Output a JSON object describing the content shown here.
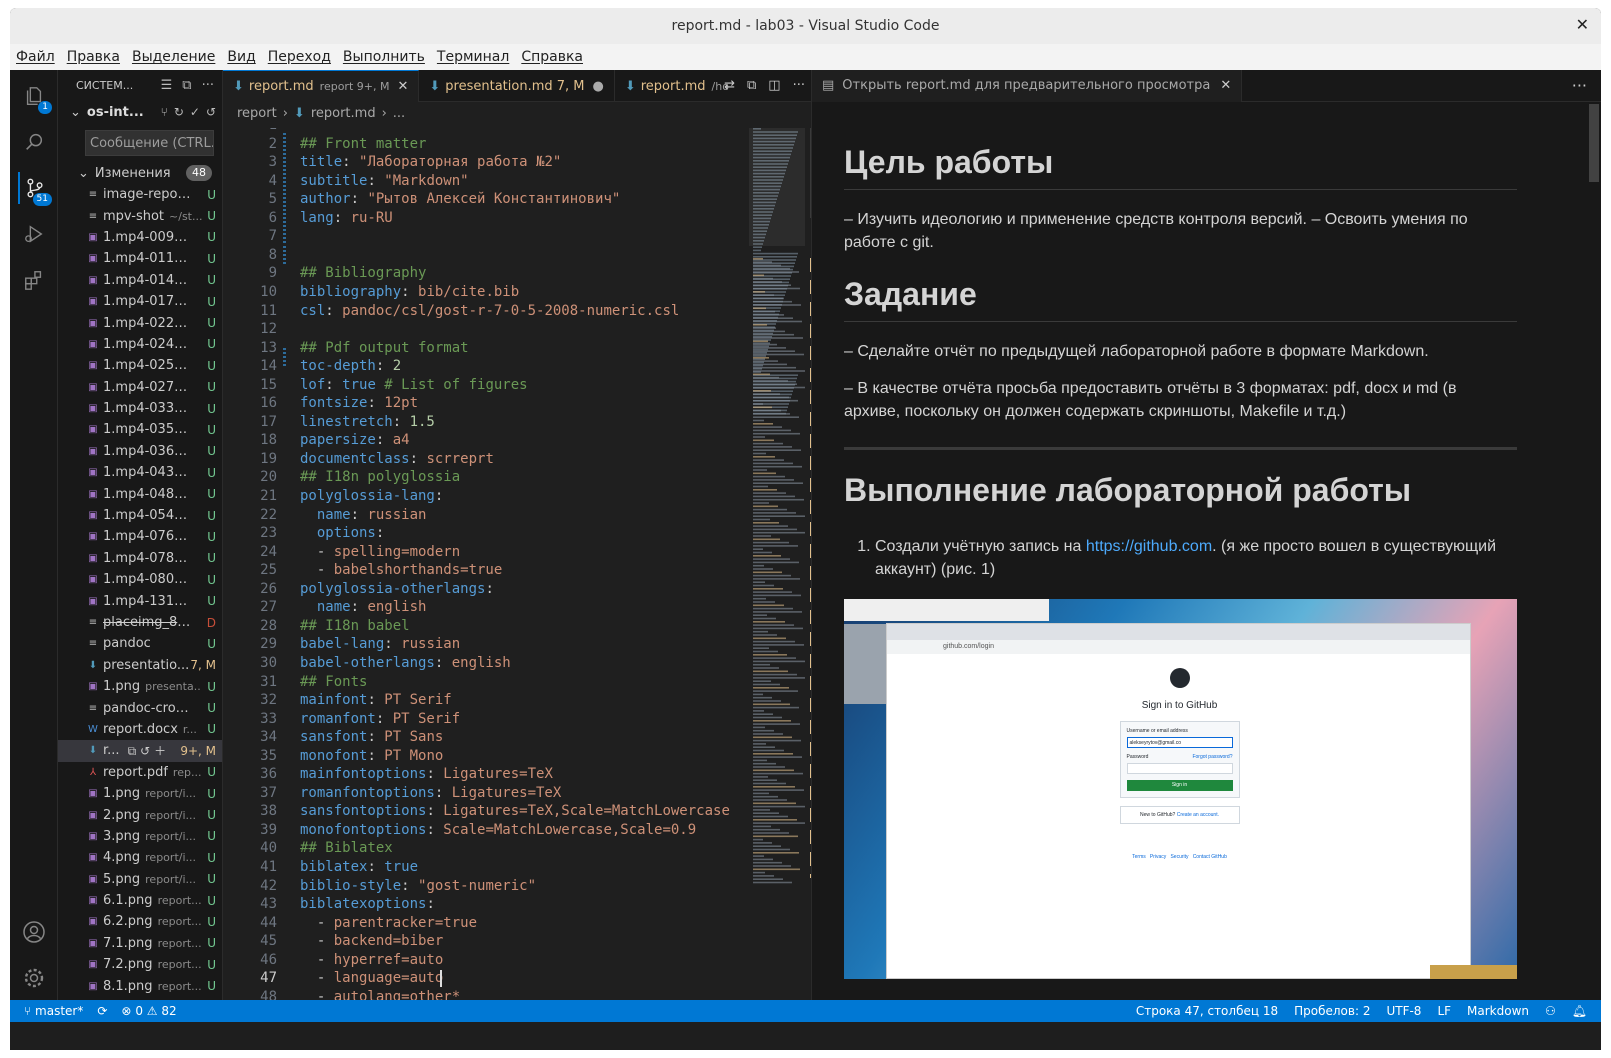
{
  "window": {
    "title": "report.md - lab03 - Visual Studio Code",
    "close": "✕"
  },
  "menu": [
    "Файл",
    "Правка",
    "Выделение",
    "Вид",
    "Переход",
    "Выполнить",
    "Терминал",
    "Справка"
  ],
  "activity": {
    "explorer_badge": "1",
    "scm_badge": "51"
  },
  "sidebar": {
    "header": "СИСТЕМ...",
    "repo": "os-int...",
    "message_placeholder": "Сообщение (CTRL...",
    "changes_label": "Изменения",
    "changes_count": "48",
    "files": [
      {
        "icon": "≡",
        "name": "image-report...",
        "dir": "",
        "status": "U"
      },
      {
        "icon": "≡",
        "name": "mpv-shot",
        "dir": "~/st...",
        "status": "U"
      },
      {
        "icon": "▣",
        "name": "1.mp4-0096.j...",
        "dir": "",
        "status": "U"
      },
      {
        "icon": "▣",
        "name": "1.mp4-0112.jp...",
        "dir": "",
        "status": "U"
      },
      {
        "icon": "▣",
        "name": "1.mp4-0144.j...",
        "dir": "",
        "status": "U"
      },
      {
        "icon": "▣",
        "name": "1.mp4-0176.jp...",
        "dir": "",
        "status": "U"
      },
      {
        "icon": "▣",
        "name": "1.mp4-0224.j...",
        "dir": "",
        "status": "U"
      },
      {
        "icon": "▣",
        "name": "1.mp4-0240.j...",
        "dir": "",
        "status": "U"
      },
      {
        "icon": "▣",
        "name": "1.mp4-0256.j...",
        "dir": "",
        "status": "U"
      },
      {
        "icon": "▣",
        "name": "1.mp4-0272.j...",
        "dir": "",
        "status": "U"
      },
      {
        "icon": "▣",
        "name": "1.mp4-0336.j...",
        "dir": "",
        "status": "U"
      },
      {
        "icon": "▣",
        "name": "1.mp4-0352.j...",
        "dir": "",
        "status": "U"
      },
      {
        "icon": "▣",
        "name": "1.mp4-0368.j...",
        "dir": "",
        "status": "U"
      },
      {
        "icon": "▣",
        "name": "1.mp4-0432.j...",
        "dir": "",
        "status": "U"
      },
      {
        "icon": "▣",
        "name": "1.mp4-0480.j...",
        "dir": "",
        "status": "U"
      },
      {
        "icon": "▣",
        "name": "1.mp4-0544.j...",
        "dir": "",
        "status": "U"
      },
      {
        "icon": "▣",
        "name": "1.mp4-0768.j...",
        "dir": "",
        "status": "U"
      },
      {
        "icon": "▣",
        "name": "1.mp4-0784.j...",
        "dir": "",
        "status": "U"
      },
      {
        "icon": "▣",
        "name": "1.mp4-0800.j...",
        "dir": "",
        "status": "U"
      },
      {
        "icon": "▣",
        "name": "1.mp4-1312.jp...",
        "dir": "",
        "status": "U"
      },
      {
        "icon": "≡",
        "name": "placeimg_80...",
        "dir": "",
        "status": "D",
        "strike": true
      },
      {
        "icon": "≡",
        "name": "pandoc",
        "dir": "",
        "status": "U"
      },
      {
        "icon": "⬇",
        "name": "presentatio...",
        "dir": "",
        "status": "7, M"
      },
      {
        "icon": "▣",
        "name": "1.png",
        "dir": "presenta...",
        "status": "U"
      },
      {
        "icon": "≡",
        "name": "pandoc-cross...",
        "dir": "",
        "status": "U"
      },
      {
        "icon": "W",
        "name": "report.docx",
        "dir": "r...",
        "status": "U"
      },
      {
        "icon": "⬇",
        "name": "r...",
        "dir": "",
        "status": "9+, M",
        "selected": true
      },
      {
        "icon": "⅄",
        "name": "report.pdf",
        "dir": "rep...",
        "status": "U"
      },
      {
        "icon": "▣",
        "name": "1.png",
        "dir": "report/i...",
        "status": "U"
      },
      {
        "icon": "▣",
        "name": "2.png",
        "dir": "report/i...",
        "status": "U"
      },
      {
        "icon": "▣",
        "name": "3.png",
        "dir": "report/i...",
        "status": "U"
      },
      {
        "icon": "▣",
        "name": "4.png",
        "dir": "report/i...",
        "status": "U"
      },
      {
        "icon": "▣",
        "name": "5.png",
        "dir": "report/i...",
        "status": "U"
      },
      {
        "icon": "▣",
        "name": "6.1.png",
        "dir": "report...",
        "status": "U"
      },
      {
        "icon": "▣",
        "name": "6.2.png",
        "dir": "report...",
        "status": "U"
      },
      {
        "icon": "▣",
        "name": "7.1.png",
        "dir": "report...",
        "status": "U"
      },
      {
        "icon": "▣",
        "name": "7.2.png",
        "dir": "report...",
        "status": "U"
      },
      {
        "icon": "▣",
        "name": "8.1.png",
        "dir": "report...",
        "status": "U"
      }
    ]
  },
  "editor": {
    "tabs": [
      {
        "label": "report.md",
        "desc": "report 9+, M",
        "close": "✕",
        "active": true
      },
      {
        "label": "presentation.md 7, M",
        "desc": "",
        "close": "●",
        "active": false
      },
      {
        "label": "report.md",
        "desc": "/ho",
        "close": "",
        "active": false
      }
    ],
    "breadcrumb": [
      "report",
      "›",
      "report.md",
      "›",
      "..."
    ],
    "current_line": 47,
    "lines": [
      {
        "n": "1",
        "t": [
          [
            "---",
            "#cccccc"
          ]
        ]
      },
      {
        "n": "2",
        "t": [
          [
            "## Front matter",
            "#6a9955"
          ]
        ]
      },
      {
        "n": "3",
        "t": [
          [
            "title",
            "#569cd6"
          ],
          [
            ": ",
            "#cccccc"
          ],
          [
            "\"Лабораторная работа №2\"",
            "#ce9178"
          ]
        ]
      },
      {
        "n": "4",
        "t": [
          [
            "subtitle",
            "#569cd6"
          ],
          [
            ": ",
            "#cccccc"
          ],
          [
            "\"Markdown\"",
            "#ce9178"
          ]
        ]
      },
      {
        "n": "5",
        "t": [
          [
            "author",
            "#569cd6"
          ],
          [
            ": ",
            "#cccccc"
          ],
          [
            "\"Рытов Алексей Константинович\"",
            "#ce9178"
          ]
        ]
      },
      {
        "n": "6",
        "t": [
          [
            "lang",
            "#569cd6"
          ],
          [
            ": ",
            "#cccccc"
          ],
          [
            "ru-RU",
            "#ce9178"
          ]
        ]
      },
      {
        "n": "7",
        "t": [
          [
            "",
            "#cccccc"
          ]
        ]
      },
      {
        "n": "8",
        "t": [
          [
            "",
            "#cccccc"
          ]
        ]
      },
      {
        "n": "9",
        "t": [
          [
            "## Bibliography",
            "#6a9955"
          ]
        ]
      },
      {
        "n": "10",
        "t": [
          [
            "bibliography",
            "#569cd6"
          ],
          [
            ": ",
            "#cccccc"
          ],
          [
            "bib/cite.bib",
            "#ce9178"
          ]
        ]
      },
      {
        "n": "11",
        "t": [
          [
            "csl",
            "#569cd6"
          ],
          [
            ": ",
            "#cccccc"
          ],
          [
            "pandoc/csl/gost-r-7-0-5-2008-numeric.csl",
            "#ce9178"
          ]
        ]
      },
      {
        "n": "12",
        "t": [
          [
            "",
            "#cccccc"
          ]
        ]
      },
      {
        "n": "13",
        "t": [
          [
            "## Pdf output format",
            "#6a9955"
          ]
        ]
      },
      {
        "n": "14",
        "t": [
          [
            "toc-depth",
            "#569cd6"
          ],
          [
            ": ",
            "#cccccc"
          ],
          [
            "2",
            "#b5cea8"
          ]
        ]
      },
      {
        "n": "15",
        "t": [
          [
            "lof",
            "#569cd6"
          ],
          [
            ": ",
            "#cccccc"
          ],
          [
            "true",
            "#569cd6"
          ],
          [
            " # List of figures",
            "#6a9955"
          ]
        ]
      },
      {
        "n": "16",
        "t": [
          [
            "fontsize",
            "#569cd6"
          ],
          [
            ": ",
            "#cccccc"
          ],
          [
            "12pt",
            "#ce9178"
          ]
        ]
      },
      {
        "n": "17",
        "t": [
          [
            "linestretch",
            "#569cd6"
          ],
          [
            ": ",
            "#cccccc"
          ],
          [
            "1.5",
            "#b5cea8"
          ]
        ]
      },
      {
        "n": "18",
        "t": [
          [
            "papersize",
            "#569cd6"
          ],
          [
            ": ",
            "#cccccc"
          ],
          [
            "a4",
            "#ce9178"
          ]
        ]
      },
      {
        "n": "19",
        "t": [
          [
            "documentclass",
            "#569cd6"
          ],
          [
            ": ",
            "#cccccc"
          ],
          [
            "scrreprt",
            "#ce9178"
          ]
        ]
      },
      {
        "n": "20",
        "t": [
          [
            "## I18n polyglossia",
            "#6a9955"
          ]
        ]
      },
      {
        "n": "21",
        "t": [
          [
            "polyglossia-lang",
            "#569cd6"
          ],
          [
            ":",
            "#cccccc"
          ]
        ]
      },
      {
        "n": "22",
        "t": [
          [
            "  name",
            "#569cd6"
          ],
          [
            ": ",
            "#cccccc"
          ],
          [
            "russian",
            "#ce9178"
          ]
        ]
      },
      {
        "n": "23",
        "t": [
          [
            "  options",
            "#569cd6"
          ],
          [
            ":",
            "#cccccc"
          ]
        ]
      },
      {
        "n": "24",
        "t": [
          [
            "  - ",
            "#cccccc"
          ],
          [
            "spelling=modern",
            "#ce9178"
          ]
        ]
      },
      {
        "n": "25",
        "t": [
          [
            "  - ",
            "#cccccc"
          ],
          [
            "babelshorthands=true",
            "#ce9178"
          ]
        ]
      },
      {
        "n": "26",
        "t": [
          [
            "polyglossia-otherlangs",
            "#569cd6"
          ],
          [
            ":",
            "#cccccc"
          ]
        ]
      },
      {
        "n": "27",
        "t": [
          [
            "  name",
            "#569cd6"
          ],
          [
            ": ",
            "#cccccc"
          ],
          [
            "english",
            "#ce9178"
          ]
        ]
      },
      {
        "n": "28",
        "t": [
          [
            "## I18n babel",
            "#6a9955"
          ]
        ]
      },
      {
        "n": "29",
        "t": [
          [
            "babel-lang",
            "#569cd6"
          ],
          [
            ": ",
            "#cccccc"
          ],
          [
            "russian",
            "#ce9178"
          ]
        ]
      },
      {
        "n": "30",
        "t": [
          [
            "babel-otherlangs",
            "#569cd6"
          ],
          [
            ": ",
            "#cccccc"
          ],
          [
            "english",
            "#ce9178"
          ]
        ]
      },
      {
        "n": "31",
        "t": [
          [
            "## Fonts",
            "#6a9955"
          ]
        ]
      },
      {
        "n": "32",
        "t": [
          [
            "mainfont",
            "#569cd6"
          ],
          [
            ": ",
            "#cccccc"
          ],
          [
            "PT Serif",
            "#ce9178"
          ]
        ]
      },
      {
        "n": "33",
        "t": [
          [
            "romanfont",
            "#569cd6"
          ],
          [
            ": ",
            "#cccccc"
          ],
          [
            "PT Serif",
            "#ce9178"
          ]
        ]
      },
      {
        "n": "34",
        "t": [
          [
            "sansfont",
            "#569cd6"
          ],
          [
            ": ",
            "#cccccc"
          ],
          [
            "PT Sans",
            "#ce9178"
          ]
        ]
      },
      {
        "n": "35",
        "t": [
          [
            "monofont",
            "#569cd6"
          ],
          [
            ": ",
            "#cccccc"
          ],
          [
            "PT Mono",
            "#ce9178"
          ]
        ]
      },
      {
        "n": "36",
        "t": [
          [
            "mainfontoptions",
            "#569cd6"
          ],
          [
            ": ",
            "#cccccc"
          ],
          [
            "Ligatures=TeX",
            "#ce9178"
          ]
        ]
      },
      {
        "n": "37",
        "t": [
          [
            "romanfontoptions",
            "#569cd6"
          ],
          [
            ": ",
            "#cccccc"
          ],
          [
            "Ligatures=TeX",
            "#ce9178"
          ]
        ]
      },
      {
        "n": "38",
        "t": [
          [
            "sansfontoptions",
            "#569cd6"
          ],
          [
            ": ",
            "#cccccc"
          ],
          [
            "Ligatures=TeX,Scale=MatchLowercase",
            "#ce9178"
          ]
        ]
      },
      {
        "n": "39",
        "t": [
          [
            "monofontoptions",
            "#569cd6"
          ],
          [
            ": ",
            "#cccccc"
          ],
          [
            "Scale=MatchLowercase,Scale=0.9",
            "#ce9178"
          ]
        ]
      },
      {
        "n": "40",
        "t": [
          [
            "## Biblatex",
            "#6a9955"
          ]
        ]
      },
      {
        "n": "41",
        "t": [
          [
            "biblatex",
            "#569cd6"
          ],
          [
            ": ",
            "#cccccc"
          ],
          [
            "true",
            "#569cd6"
          ]
        ]
      },
      {
        "n": "42",
        "t": [
          [
            "biblio-style",
            "#569cd6"
          ],
          [
            ": ",
            "#cccccc"
          ],
          [
            "\"gost-numeric\"",
            "#ce9178"
          ]
        ]
      },
      {
        "n": "43",
        "t": [
          [
            "biblatexoptions",
            "#569cd6"
          ],
          [
            ":",
            "#cccccc"
          ]
        ]
      },
      {
        "n": "44",
        "t": [
          [
            "  - ",
            "#cccccc"
          ],
          [
            "parentracker=true",
            "#ce9178"
          ]
        ]
      },
      {
        "n": "45",
        "t": [
          [
            "  - ",
            "#cccccc"
          ],
          [
            "backend=biber",
            "#ce9178"
          ]
        ]
      },
      {
        "n": "46",
        "t": [
          [
            "  - ",
            "#cccccc"
          ],
          [
            "hyperref=auto",
            "#ce9178"
          ]
        ]
      },
      {
        "n": "47",
        "t": [
          [
            "  - ",
            "#cccccc"
          ],
          [
            "language=auto",
            "#ce9178"
          ]
        ]
      },
      {
        "n": "48",
        "t": [
          [
            "  - ",
            "#cccccc"
          ],
          [
            "autolang=other*",
            "#ce9178"
          ]
        ]
      }
    ]
  },
  "preview": {
    "tab_label": "Открыть report.md для предварительного просмотра",
    "tab_close": "✕",
    "more": "···",
    "h1_goal": "Цель работы",
    "p_goal": "– Изучить идеологию и применение средств контроля версий. – Освоить умения по работе с git.",
    "h1_task": "Задание",
    "p_task1": "– Сделайте отчёт по предыдущей лабораторной работе в формате Markdown.",
    "p_task2": "– В качестве отчёта просьба предоставить отчёты в 3 форматах: pdf, docx и md (в архиве, поскольку он должен содержать скриншоты, Makefile и т.д.)",
    "h1_exec": "Выполнение лабораторной работы",
    "li1_pre": "Создали учётную запись на ",
    "li1_link": "https://github.com",
    "li1_post": ". (я же просто вошел в существующий аккаунт) (рис. 1)",
    "shot": {
      "url": "github.com/login",
      "title": "Sign in to GitHub",
      "username_label": "Username or email address",
      "username_value": "alekseyrytov@gmail.co",
      "password_label": "Password",
      "forgot": "Forgot password?",
      "signin": "Sign in",
      "new": "New to GitHub?",
      "create": "Create an account.",
      "footer": "Terms   Privacy   Security   Contact GitHub"
    }
  },
  "status": {
    "branch": "master*",
    "sync": "⟳",
    "errors": "0",
    "warnings": "82",
    "position": "Строка 47, столбец 18",
    "spaces": "Пробелов: 2",
    "encoding": "UTF-8",
    "eol": "LF",
    "language": "Markdown"
  },
  "colors": {
    "accent": "#0078d4",
    "status_bg": "#0078d4",
    "untracked": "#73c991",
    "deleted": "#c74e39",
    "modified": "#e2c08d"
  }
}
